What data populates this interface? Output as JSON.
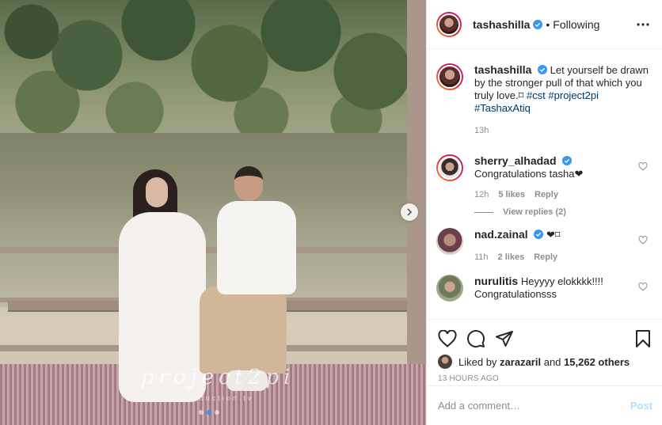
{
  "photo": {
    "watermark": "project2pi",
    "watermark_sub": "production.tv",
    "carousel_dots": 3,
    "carousel_active_index": 1
  },
  "header": {
    "username": "tashashilla",
    "separator": "•",
    "follow_status": "Following"
  },
  "caption": {
    "username": "tashashilla",
    "text": "Let yourself be drawn by the stronger pull of that which you truly love.",
    "emoji": "⌑",
    "tags": [
      "#cst",
      "#project2pi",
      "#TashaxAtiq"
    ],
    "time": "13h"
  },
  "comments": [
    {
      "username": "sherry_alhadad",
      "verified": true,
      "text": "Congratulations tasha❤",
      "time": "12h",
      "likes": "5 likes",
      "reply": "Reply",
      "view_replies": "View replies (2)"
    },
    {
      "username": "nad.zainal",
      "verified": true,
      "text": "❤⌑",
      "time": "11h",
      "likes": "2 likes",
      "reply": "Reply"
    },
    {
      "username": "nurulitis",
      "verified": false,
      "text": "Heyyyy elokkkk!!!! Congratulationsss"
    }
  ],
  "likes": {
    "prefix": "Liked by",
    "user": "zarazaril",
    "and": "and",
    "count": "15,262 others"
  },
  "timeago": "13 HOURS AGO",
  "add_comment": {
    "placeholder": "Add a comment…",
    "post_label": "Post"
  },
  "colors": {
    "verified": "#3897f0",
    "tag": "#00376b",
    "muted": "#8e8e8e",
    "post_disabled": "#b2dffc"
  }
}
